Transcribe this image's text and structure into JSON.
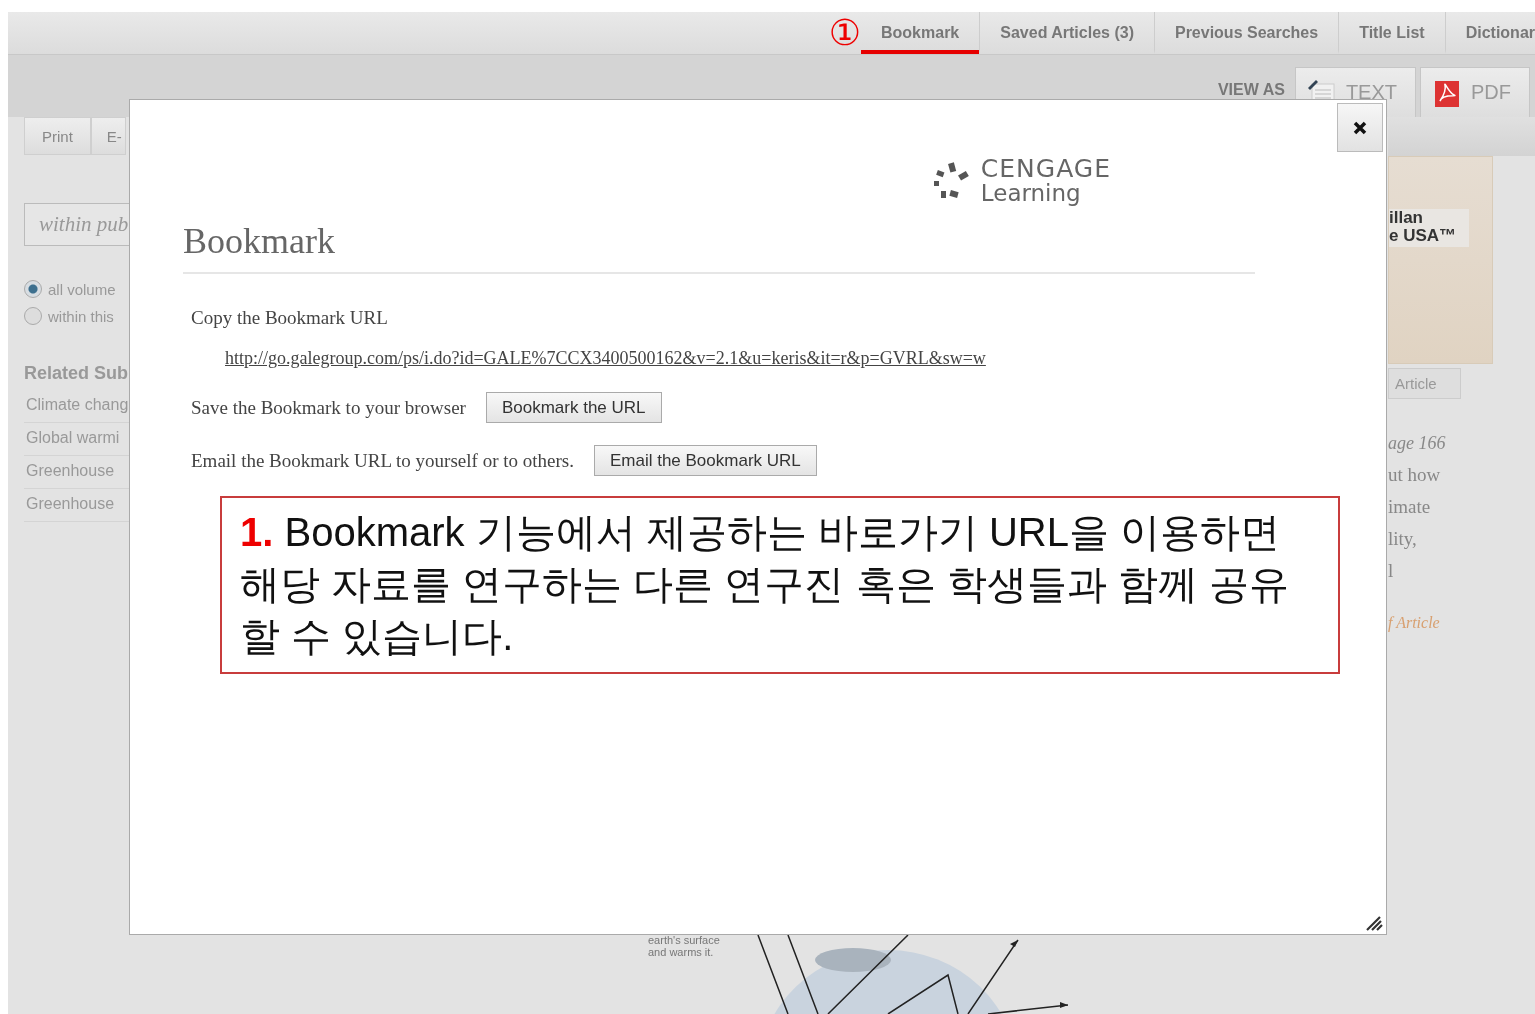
{
  "annotation_marker": "①",
  "tabs": [
    {
      "label": "Bookmark",
      "selected": true
    },
    {
      "label": "Saved Articles (3)",
      "selected": false
    },
    {
      "label": "Previous Searches",
      "selected": false
    },
    {
      "label": "Title List",
      "selected": false
    },
    {
      "label": "Dictionar",
      "selected": false
    }
  ],
  "view_as": {
    "label": "VIEW AS",
    "options": [
      {
        "label": "TEXT",
        "kind": "text"
      },
      {
        "label": "PDF",
        "kind": "pdf"
      }
    ]
  },
  "left_panel": {
    "tools": [
      "Print",
      "E-"
    ],
    "search": {
      "placeholder": "within pub"
    },
    "scope": [
      {
        "label": "all volume",
        "selected": true
      },
      {
        "label": "within this",
        "selected": false
      }
    ],
    "related_heading": "Related Sub",
    "related": [
      "Climate chang",
      "Global warmi",
      "Greenhouse",
      "Greenhouse"
    ]
  },
  "modal": {
    "logo": {
      "line1": "CENGAGE",
      "line2": "Learning"
    },
    "title": "Bookmark",
    "copy_label": "Copy the Bookmark URL",
    "url": "http://go.galegroup.com/ps/i.do?id=GALE%7CCX3400500162&v=2.1&u=keris&it=r&p=GVRL&sw=w",
    "actions": [
      {
        "label": "Save the Bookmark to your browser",
        "button": "Bookmark the URL"
      },
      {
        "label": "Email the Bookmark URL to yourself or to others.",
        "button": "Email the Bookmark URL"
      }
    ],
    "callout": "**1.** Bookmark 기능에서 제공하는 바로가기 URL을 이용하면 해당 자료를 연구하는 다른 연구진 혹은 학생들과 함께 공유할 수 있습니다."
  },
  "figure": {
    "caption": "earth's surface and warms it."
  },
  "right_panel": {
    "cover_lines": [
      "illan",
      "e USA™"
    ],
    "button": "Article",
    "page": "age 166",
    "text_lines": [
      "ut how",
      "imate",
      "lity,",
      "l"
    ],
    "link": "f Article"
  }
}
